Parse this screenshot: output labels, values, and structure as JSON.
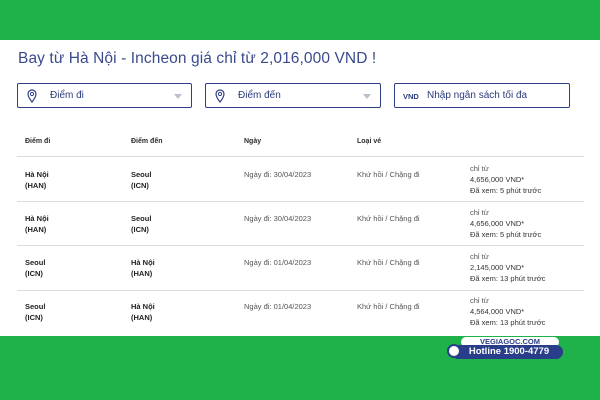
{
  "title": "Bay từ Hà Nội - Incheon giá chỉ từ 2,016,000 VND !",
  "search": {
    "origin_placeholder": "Điểm đi",
    "destination_placeholder": "Điểm đến",
    "currency": "VND",
    "budget_placeholder": "Nhập ngân sách tối đa"
  },
  "table": {
    "headers": [
      "Điểm đi",
      "Điểm đến",
      "Ngày",
      "Loại vé"
    ],
    "rows": [
      {
        "from_city": "Hà Nội",
        "from_code": "(HAN)",
        "to_city": "Seoul",
        "to_code": "(ICN)",
        "date": "Ngày đi: 30/04/2023",
        "type": "Khứ hồi / Chặng đi",
        "price_prefix": "chỉ từ",
        "price": "4,656,000 VND*",
        "viewed": "Đã xem: 5 phút trước"
      },
      {
        "from_city": "Hà Nội",
        "from_code": "(HAN)",
        "to_city": "Seoul",
        "to_code": "(ICN)",
        "date": "Ngày đi: 30/04/2023",
        "type": "Khứ hồi / Chặng đi",
        "price_prefix": "chỉ từ",
        "price": "4,656,000 VND*",
        "viewed": "Đã xem: 5 phút trước"
      },
      {
        "from_city": "Seoul",
        "from_code": "(ICN)",
        "to_city": "Hà Nội",
        "to_code": "(HAN)",
        "date": "Ngày đi: 01/04/2023",
        "type": "Khứ hồi / Chặng đi",
        "price_prefix": "chỉ từ",
        "price": "2,145,000 VND*",
        "viewed": "Đã xem: 13 phút trước"
      },
      {
        "from_city": "Seoul",
        "from_code": "(ICN)",
        "to_city": "Hà Nội",
        "to_code": "(HAN)",
        "date": "Ngày đi: 01/04/2023",
        "type": "Khứ hồi / Chặng đi",
        "price_prefix": "chỉ từ",
        "price": "4,564,000 VND*",
        "viewed": "Đã xem: 13 phút trước"
      }
    ]
  },
  "branding": {
    "site": "VEGIAGOC.COM",
    "hotline": "Hotline 1900-4779"
  },
  "colors": {
    "brand_green": "#1fb14a",
    "accent_navy": "#2f3f86"
  }
}
